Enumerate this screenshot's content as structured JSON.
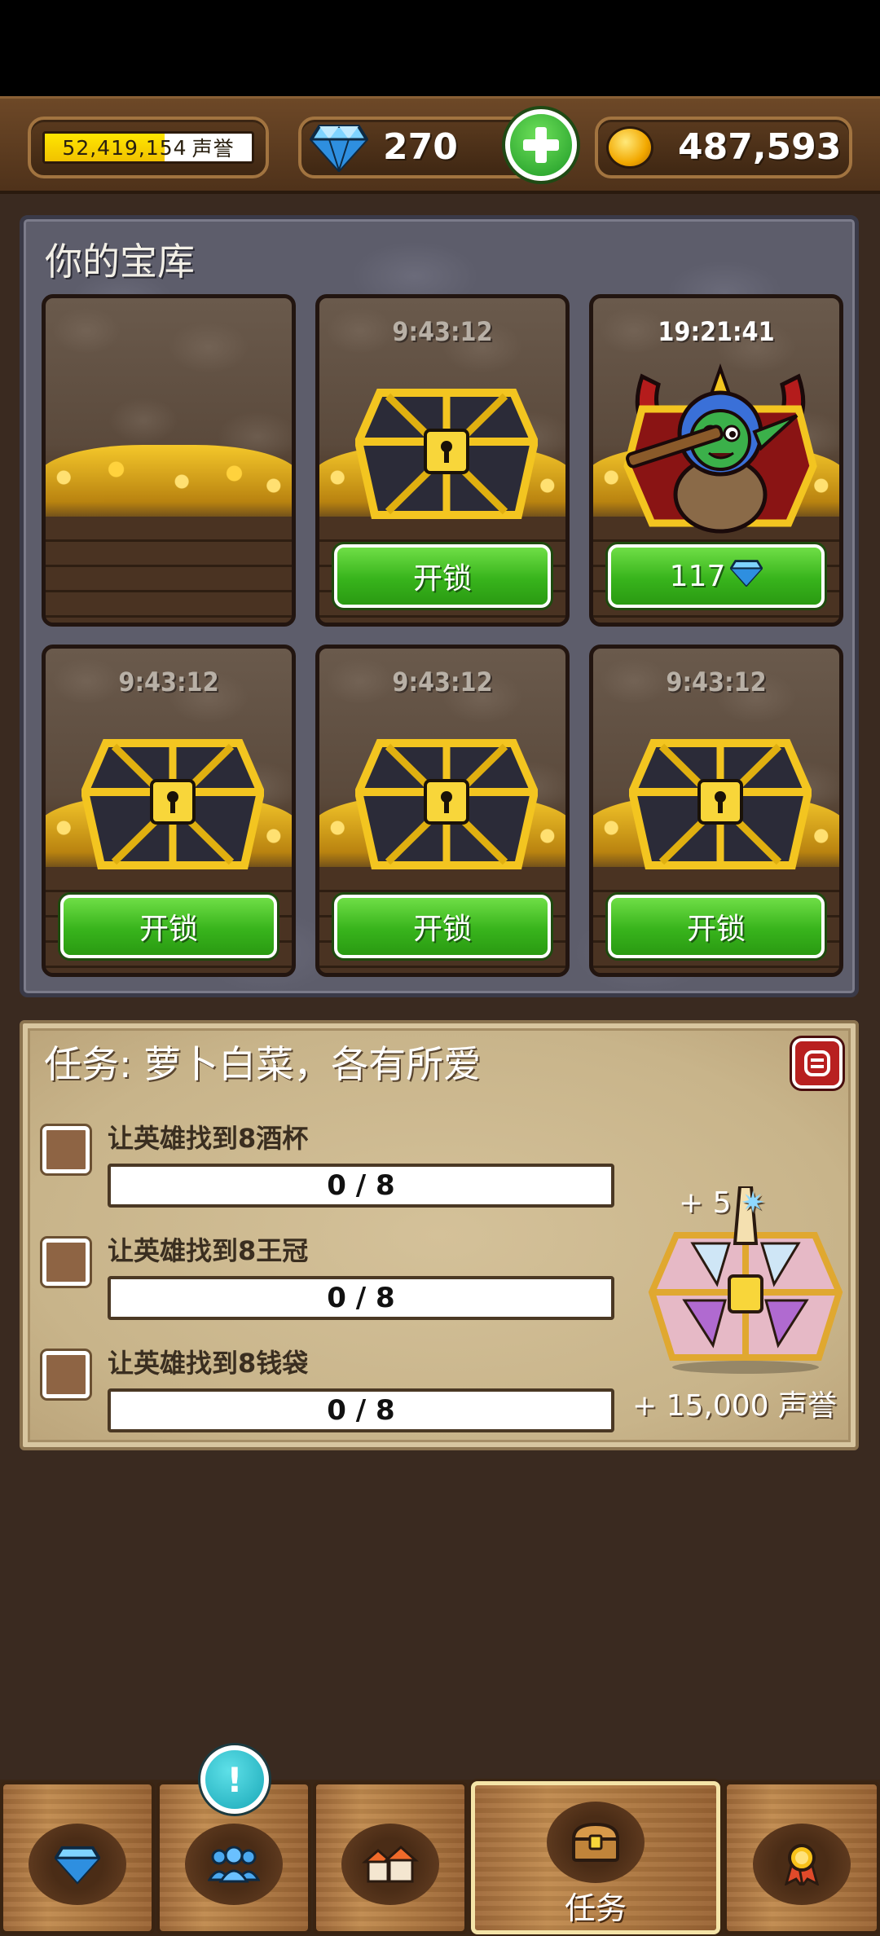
{
  "header": {
    "reputation": {
      "value": "52,419,154",
      "unit": "声誉",
      "fill_fraction": 0.58
    },
    "gems": {
      "count": "270"
    },
    "coins": {
      "count": "487,593"
    }
  },
  "vault": {
    "title": "你的宝库",
    "slots": [
      {
        "state": "empty",
        "timer": "",
        "button": ""
      },
      {
        "state": "locked",
        "timer": "9:43:12",
        "button": "开锁"
      },
      {
        "state": "unlocking",
        "timer": "19:21:41",
        "button": "117"
      },
      {
        "state": "locked",
        "timer": "9:43:12",
        "button": "开锁"
      },
      {
        "state": "locked",
        "timer": "9:43:12",
        "button": "开锁"
      },
      {
        "state": "locked",
        "timer": "9:43:12",
        "button": "开锁"
      }
    ]
  },
  "quest": {
    "title": "任务: 萝卜白菜，各有所爱",
    "tasks": [
      {
        "label": "让英雄找到8酒杯",
        "progress": "0 / 8",
        "done": 0,
        "total": 8
      },
      {
        "label": "让英雄找到8王冠",
        "progress": "0 / 8",
        "done": 0,
        "total": 8
      },
      {
        "label": "让英雄找到8钱袋",
        "progress": "0 / 8",
        "done": 0,
        "total": 8
      }
    ],
    "reward_gems": "+ 5",
    "reward_reputation": "+ 15,000 声誉"
  },
  "nav": {
    "tabs": [
      {
        "icon": "gem-shop-icon",
        "label": ""
      },
      {
        "icon": "heroes-icon",
        "label": ""
      },
      {
        "icon": "town-icon",
        "label": ""
      },
      {
        "icon": "quest-chest-icon",
        "label": "任务",
        "active": true
      },
      {
        "icon": "achievement-medal-icon",
        "label": ""
      }
    ],
    "alert": "!"
  },
  "colors": {
    "button_green": "#38b41c",
    "gem_blue": "#3aa8f0",
    "gold": "#f2c200",
    "alert_cyan": "#1aa8b8"
  }
}
